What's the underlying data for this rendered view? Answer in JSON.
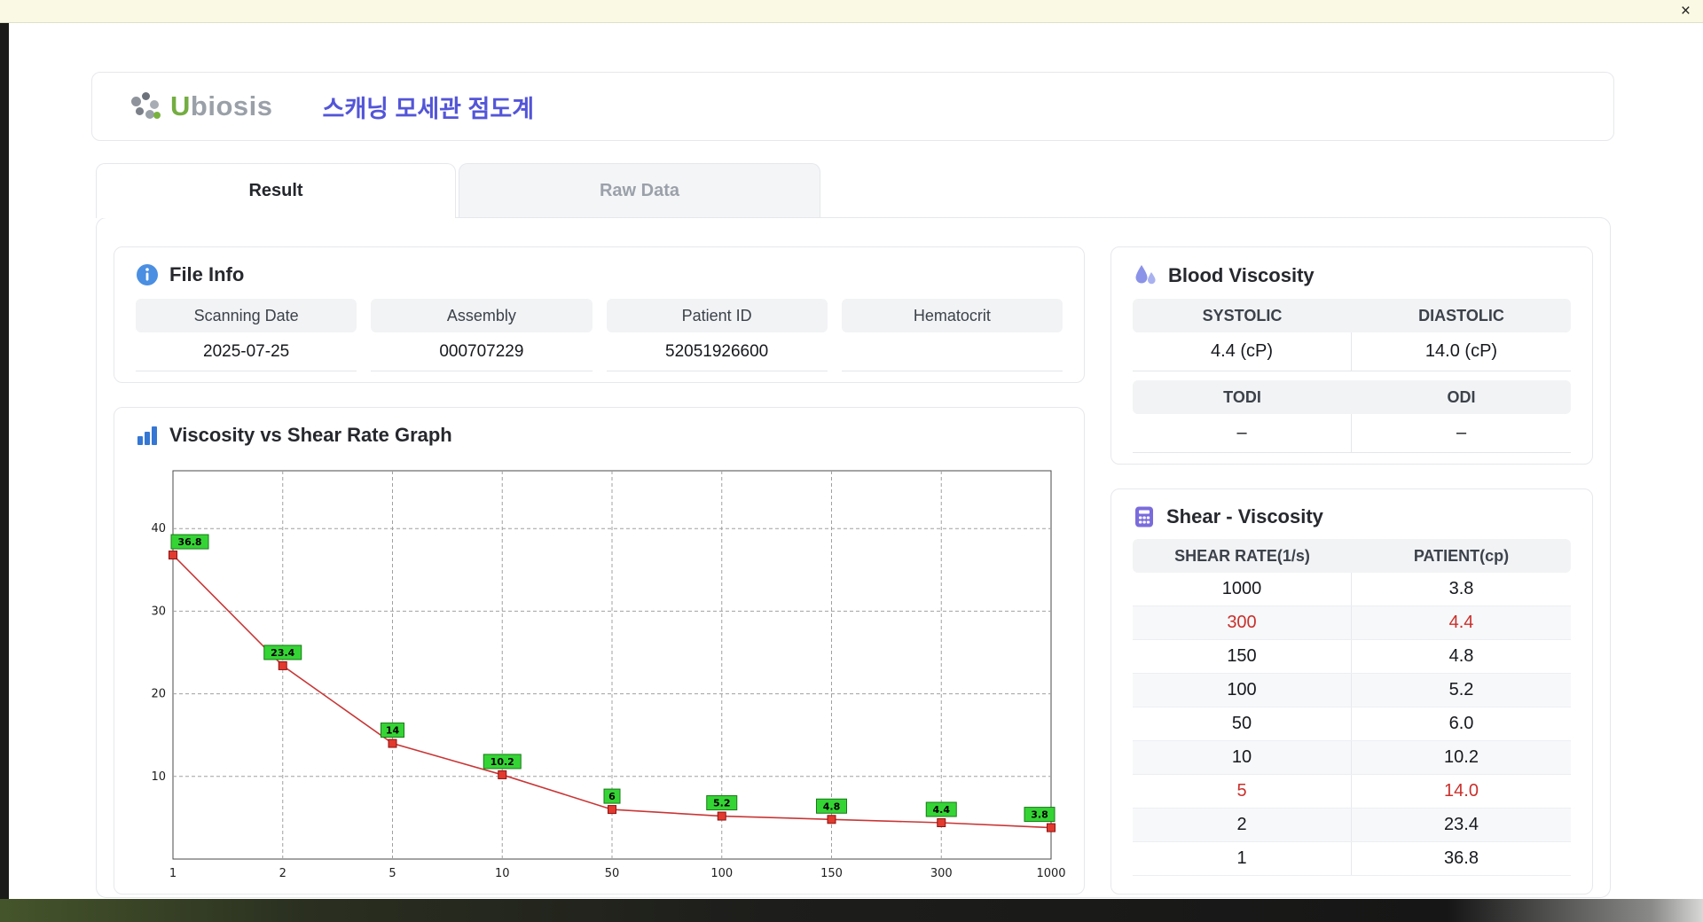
{
  "window": {
    "close_label": "×"
  },
  "brand": {
    "u": "U",
    "rest": "biosis"
  },
  "header": {
    "title": "스캐닝 모세관 점도계"
  },
  "tabs": [
    {
      "label": "Result",
      "active": true
    },
    {
      "label": "Raw Data",
      "active": false
    }
  ],
  "file_info": {
    "title": "File Info",
    "fields": [
      {
        "label": "Scanning Date",
        "value": "2025-07-25"
      },
      {
        "label": "Assembly",
        "value": "000707229"
      },
      {
        "label": "Patient ID",
        "value": "52051926600"
      },
      {
        "label": "Hematocrit",
        "value": ""
      }
    ]
  },
  "blood_viscosity": {
    "title": "Blood Viscosity",
    "groups": [
      {
        "headers": [
          "SYSTOLIC",
          "DIASTOLIC"
        ],
        "values": [
          "4.4 (cP)",
          "14.0 (cP)"
        ]
      },
      {
        "headers": [
          "TODI",
          "ODI"
        ],
        "values": [
          "–",
          "–"
        ]
      }
    ]
  },
  "shear_viscosity": {
    "title": "Shear - Viscosity",
    "columns": [
      "SHEAR RATE(1/s)",
      "PATIENT(cp)"
    ],
    "rows": [
      {
        "shear": "1000",
        "patient": "3.8",
        "highlight": false
      },
      {
        "shear": "300",
        "patient": "4.4",
        "highlight": true
      },
      {
        "shear": "150",
        "patient": "4.8",
        "highlight": false
      },
      {
        "shear": "100",
        "patient": "5.2",
        "highlight": false
      },
      {
        "shear": "50",
        "patient": "6.0",
        "highlight": false
      },
      {
        "shear": "10",
        "patient": "10.2",
        "highlight": false
      },
      {
        "shear": "5",
        "patient": "14.0",
        "highlight": true
      },
      {
        "shear": "2",
        "patient": "23.4",
        "highlight": false
      },
      {
        "shear": "1",
        "patient": "36.8",
        "highlight": false
      }
    ]
  },
  "chart_data": {
    "type": "line",
    "title": "Viscosity vs Shear Rate Graph",
    "categories": [
      "1",
      "2",
      "5",
      "10",
      "50",
      "100",
      "150",
      "300",
      "1000"
    ],
    "values": [
      36.8,
      23.4,
      14,
      10.2,
      6,
      5.2,
      4.8,
      4.4,
      3.8
    ],
    "point_labels": [
      "36.8",
      "23.4",
      "14",
      "10.2",
      "6",
      "5.2",
      "4.8",
      "4.4",
      "3.8"
    ],
    "xlabel": "",
    "ylabel": "",
    "yticks": [
      10,
      20,
      30,
      40
    ],
    "ylim": [
      0,
      47
    ],
    "x_scale": "categorical",
    "grid": true,
    "legend": false,
    "line_color": "#c93636",
    "marker_color": "#e23a2e",
    "marker_border": "#8f1010",
    "label_bg": "#35d435",
    "label_border": "#167a16"
  }
}
